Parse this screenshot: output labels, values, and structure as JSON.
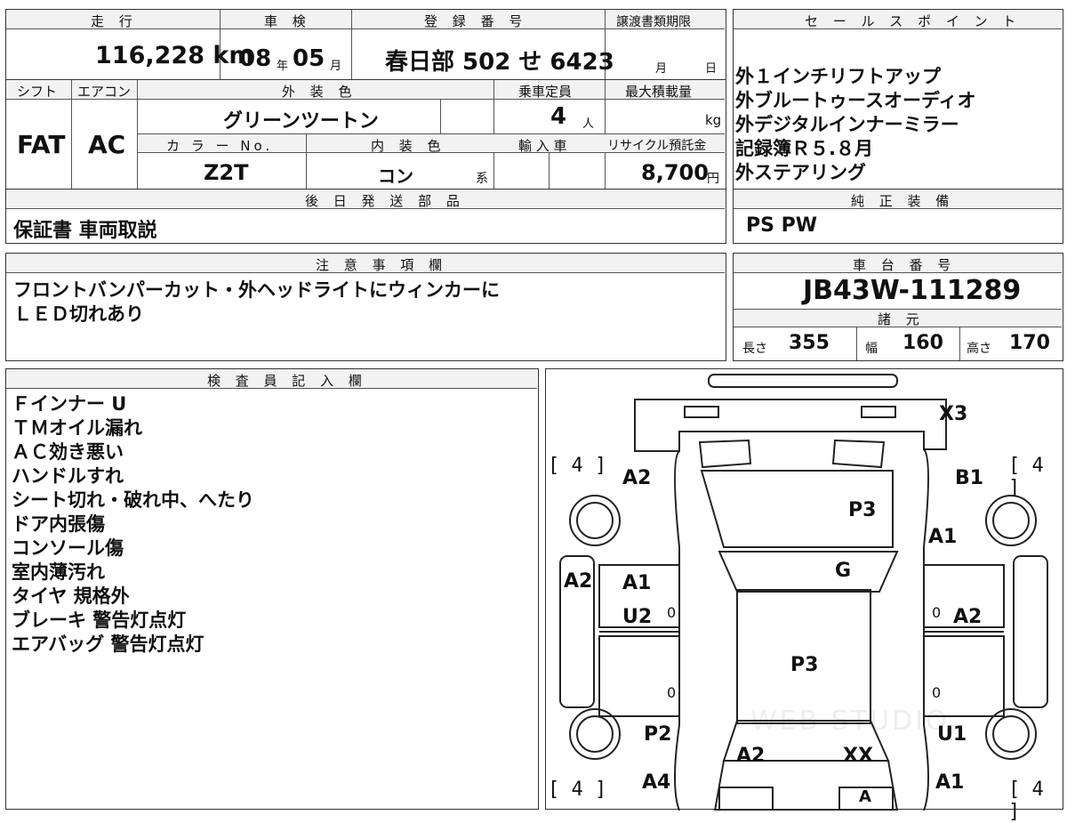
{
  "top": {
    "mileage_label": "走 行",
    "mileage": "116,228 km",
    "shaken_label": "車 検",
    "shaken_year": "08",
    "shaken_year_unit": "年",
    "shaken_month": "05",
    "shaken_month_unit": "月",
    "plate_label": "登 録 番 号",
    "plate": "春日部 502 せ 6423",
    "transfer_label": "譲渡書類期限",
    "transfer_month_unit": "月",
    "transfer_day_unit": "日"
  },
  "row2": {
    "shift_label": "シフト",
    "ac_label": "エアコン",
    "exterior_label": "外 装 色",
    "capacity_label": "乗車定員",
    "maxload_label": "最大積載量",
    "shift": "FAT",
    "ac": "AC",
    "exterior_color": "グリーンツートン",
    "capacity": "4",
    "capacity_unit": "人",
    "maxload_unit": "kg",
    "color_no_label": "カ ラ ー No.",
    "interior_label": "内 装 色",
    "import_label": "輸 入 車",
    "recycle_label": "リサイクル預託金",
    "color_no": "Z2T",
    "interior": "コン",
    "interior_suffix": "系",
    "recycle": "8,700",
    "recycle_unit": "円"
  },
  "later": {
    "label": "後 日 発 送 部 品",
    "value": "保証書 車両取説"
  },
  "sales": {
    "label": "セ ー ル ス ポ イ ン ト",
    "items": [
      "外１インチリフトアップ",
      "外ブルートゥースオーディオ",
      "外デジタルインナーミラー",
      "記録簿Ｒ５.８月",
      "外ステアリング"
    ]
  },
  "genuine": {
    "label": "純 正 装 備",
    "value": "PS PW"
  },
  "notes": {
    "label": "注 意 事 項 欄",
    "lines": [
      "フロントバンパーカット・外ヘッドライトにウィンカーに",
      "ＬＥＤ切れあり"
    ]
  },
  "chassis": {
    "label": "車 台 番 号",
    "value": "JB43W-111289"
  },
  "specs": {
    "label": "諸 元",
    "length_label": "長さ",
    "length": "355",
    "width_label": "幅",
    "width": "160",
    "height_label": "高さ",
    "height": "170"
  },
  "inspector": {
    "label": "検 査 員 記 入 欄",
    "lines": [
      "Ｆインナー U",
      "ＴＭオイル漏れ",
      "ＡＣ効き悪い",
      "ハンドルすれ",
      "シート切れ・破れ中、へたり",
      "ドア内張傷",
      "コンソール傷",
      "室内薄汚れ",
      "タイヤ 規格外",
      "ブレーキ 警告灯点灯",
      "エアバッグ 警告灯点灯"
    ]
  },
  "diagram": {
    "tire_fl": "[ 4 ]",
    "tire_fr": "[ 4 ]",
    "tire_rl": "[ 4 ]",
    "tire_rr": "[ 4 ]",
    "marks": {
      "x3": "X3",
      "a2_front_left": "A2",
      "b1_front_right": "B1",
      "p3_hood": "P3",
      "a1_front_right": "A1",
      "g_windshield": "G",
      "a2_left_panel": "A2",
      "a1_left_door": "A1",
      "u2_left_door": "U2",
      "a2_right_door": "A2",
      "p3_roof": "P3",
      "p2_rear_left": "P2",
      "u1_rear_right": "U1",
      "a2_rear": "A2",
      "xx_rear": "XX",
      "a4_rear_left": "A4",
      "a1_rear_right": "A1",
      "a_bottom": "A"
    },
    "zero_marks": [
      "0",
      "0",
      "0",
      "0"
    ],
    "watermark": "WEB STUDIO"
  }
}
